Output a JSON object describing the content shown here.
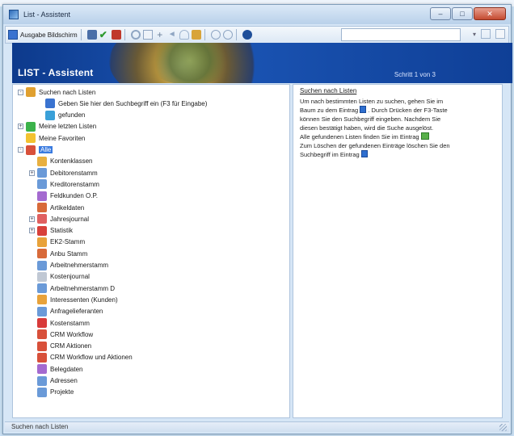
{
  "window": {
    "title": "List - Assistent",
    "caption_buttons": [
      "–",
      "□",
      "✕"
    ]
  },
  "toolbar": {
    "output_label": "Ausgabe Bildschirm",
    "right_arrow": "▾"
  },
  "banner": {
    "title": "LIST - Assistent",
    "page": "Schritt 1 von 3"
  },
  "tree": [
    {
      "label": "Suchen nach Listen",
      "level": 0,
      "expand": "-",
      "icon": "search-icon",
      "color": "#e0a030"
    },
    {
      "label": "Geben Sie hier den Suchbegriff ein (F3 für Eingabe)",
      "level": 2,
      "expand": "",
      "icon": "info-icon",
      "color": "#3a73d0"
    },
    {
      "label": "gefunden",
      "level": 2,
      "expand": "",
      "icon": "list-found-icon",
      "color": "#3aa0d8"
    },
    {
      "label": "Meine letzten Listen",
      "level": 0,
      "expand": "+",
      "icon": "recent-icon",
      "color": "#3bb24a"
    },
    {
      "label": "Meine Favoriten",
      "level": 0,
      "expand": "",
      "icon": "star-icon",
      "color": "#f2c230"
    },
    {
      "label": "Alle",
      "level": 0,
      "expand": "-",
      "icon": "all-lists-icon",
      "color": "#d8503a",
      "selected": true
    },
    {
      "label": "Kontenklassen",
      "level": 1,
      "expand": "",
      "icon": "folder-icon",
      "color": "#e8b040"
    },
    {
      "label": "Debitorenstamm",
      "level": 1,
      "expand": "+",
      "icon": "people-icon",
      "color": "#6a9ad8"
    },
    {
      "label": "Kreditorenstamm",
      "level": 1,
      "expand": "",
      "icon": "people-icon",
      "color": "#6a9ad8"
    },
    {
      "label": "Feldkunden O.P.",
      "level": 1,
      "expand": "",
      "icon": "form-icon",
      "color": "#a46ad0"
    },
    {
      "label": "Artikeldaten",
      "level": 1,
      "expand": "",
      "icon": "box-icon",
      "color": "#d86a3a"
    },
    {
      "label": "Jahresjournal",
      "level": 1,
      "expand": "+",
      "icon": "journal-icon",
      "color": "#e06060"
    },
    {
      "label": "Statistik",
      "level": 1,
      "expand": "+",
      "icon": "chart-icon",
      "color": "#d8403a"
    },
    {
      "label": "EK2-Stamm",
      "level": 1,
      "expand": "",
      "icon": "stock-icon",
      "color": "#e8a23a"
    },
    {
      "label": "Anbu Stamm",
      "level": 1,
      "expand": "",
      "icon": "doc-icon",
      "color": "#d86a3a"
    },
    {
      "label": "Arbeitnehmerstamm",
      "level": 1,
      "expand": "",
      "icon": "people-icon",
      "color": "#6a9ad8"
    },
    {
      "label": "Kostenjournal",
      "level": 1,
      "expand": "",
      "icon": "sheet-icon",
      "color": "#c0c8d4"
    },
    {
      "label": "Arbeitnehmerstamm D",
      "level": 1,
      "expand": "",
      "icon": "people-icon",
      "color": "#6a9ad8"
    },
    {
      "label": "Interessenten (Kunden)",
      "level": 1,
      "expand": "",
      "icon": "people-icon",
      "color": "#e8a23a"
    },
    {
      "label": "Anfragelieferanten",
      "level": 1,
      "expand": "",
      "icon": "people-icon",
      "color": "#6a9ad8"
    },
    {
      "label": "Kostenstamm",
      "level": 1,
      "expand": "",
      "icon": "cost-icon",
      "color": "#d83a3a"
    },
    {
      "label": "CRM Workflow",
      "level": 1,
      "expand": "",
      "icon": "crm-icon",
      "color": "#d8503a"
    },
    {
      "label": "CRM Aktionen",
      "level": 1,
      "expand": "",
      "icon": "crm-icon",
      "color": "#d8503a"
    },
    {
      "label": "CRM Workflow und Aktionen",
      "level": 1,
      "expand": "",
      "icon": "crm-icon",
      "color": "#d8503a"
    },
    {
      "label": "Belegdaten",
      "level": 1,
      "expand": "",
      "icon": "receipt-icon",
      "color": "#a46ad0"
    },
    {
      "label": "Adressen",
      "level": 1,
      "expand": "",
      "icon": "address-icon",
      "color": "#6a9ad8"
    },
    {
      "label": "Projekte",
      "level": 1,
      "expand": "",
      "icon": "project-icon",
      "color": "#6a9ad8"
    }
  ],
  "help": {
    "title": "Suchen nach Listen",
    "lines": [
      "Um nach bestimmten Listen zu suchen, gehen Sie im",
      "Baum zu dem Eintrag",
      ". Durch Drücken der F3-Taste",
      "können Sie den Suchbegriff eingeben. Nachdem Sie",
      "diesen bestätigt haben, wird die Suche ausgelöst.",
      "Alle gefundenen Listen finden Sie im Eintrag",
      "Zum Löschen der gefundenen Einträge löschen Sie den",
      "Suchbegriff im Eintrag"
    ]
  },
  "status": {
    "text": "Suchen nach Listen"
  }
}
